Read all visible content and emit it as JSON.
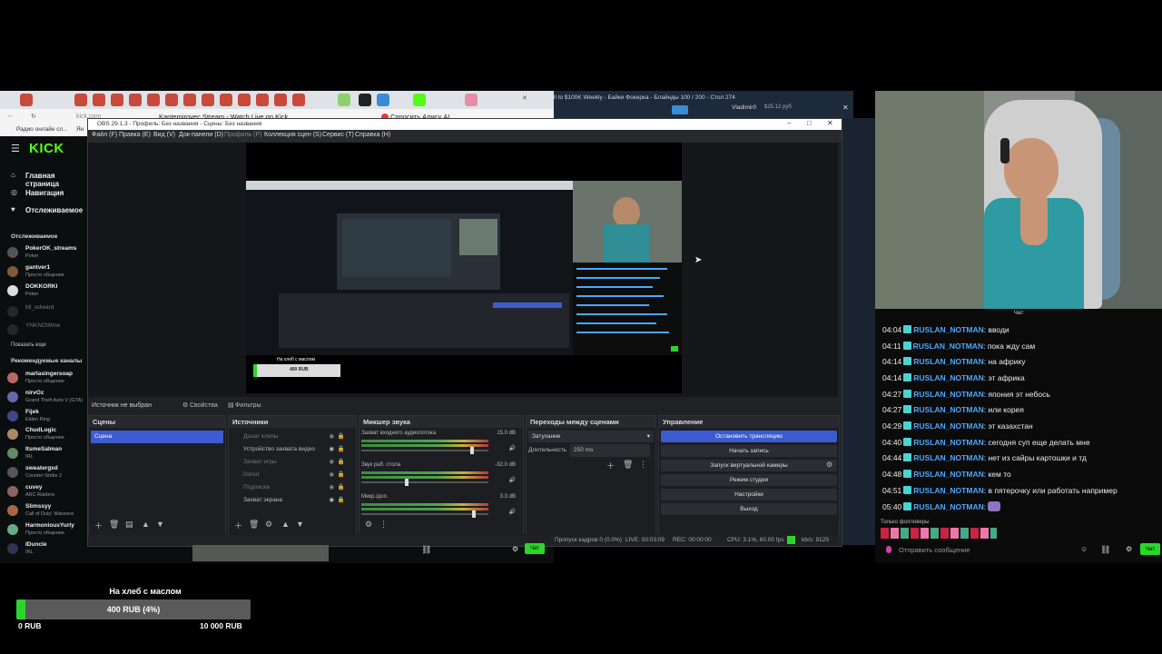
{
  "browser": {
    "page_tab_title": "Kantemirovec Stream - Watch Live on Kick",
    "address": "kick.com",
    "search_button": "Спросить Алису AI",
    "bookmark": "Радио онлайн сл...",
    "bookmark2": "Ян",
    "second_window_title": "ll to $100K Weekly - Байки Фокерка - Блайнды 100 / 200 - Стол 274",
    "second_window_user": "Vladimir0",
    "second_window_balance": "$25.12 руб"
  },
  "kick": {
    "logo": "KICK",
    "nav": [
      "Главная страница",
      "Навигация",
      "Отслеживаемое"
    ],
    "followed_header": "Отслеживаемое",
    "followed": [
      {
        "name": "PokerOK_streams",
        "game": "Poker"
      },
      {
        "name": "gantver1",
        "game": "Просто общение"
      },
      {
        "name": "DOKKORKI",
        "game": "Poker"
      },
      {
        "name": "bil_edward",
        "game": ""
      },
      {
        "name": "YNKNOWme",
        "game": ""
      }
    ],
    "show_more": "Показать еще",
    "recommended_header": "Рекомендуемые каналы",
    "recommended": [
      {
        "name": "marlasingersoap",
        "game": "Просто общение"
      },
      {
        "name": "nirvOz",
        "game": "Grand Theft Auto V (GTA)"
      },
      {
        "name": "Fijek",
        "game": "Elden Ring"
      },
      {
        "name": "ChudLogic",
        "game": "Просто общение"
      },
      {
        "name": "ItsmeSalman",
        "game": "IRL"
      },
      {
        "name": "sweatergxd",
        "game": "Counter-Strike 2"
      },
      {
        "name": "cuvey",
        "game": "ARC Raiders"
      },
      {
        "name": "Slimssyy",
        "game": "Call of Duty: Warzone"
      },
      {
        "name": "HarmoniousYurly",
        "game": "Просто общение"
      },
      {
        "name": "IDuncle",
        "game": "IRL"
      }
    ]
  },
  "obs": {
    "window_title": "OBS 29.1.3 - Профиль: Без названия - Сцены: Без названия",
    "menu": [
      "Файл (F)",
      "Правка (E)",
      "Вид (V)",
      "Док-панели (D)",
      "Профиль (P)",
      "Коллекция сцен (S)",
      "Сервис (T)",
      "Справка (H)"
    ],
    "source_selected": "Источник не выбран",
    "properties_button": "Свойства",
    "filters_button": "Фильтры",
    "scenes": {
      "title": "Сцены",
      "items": [
        "Сцена"
      ]
    },
    "sources": {
      "title": "Источники",
      "items": [
        "Донат клипы",
        "Устройство захвата видео",
        "Захват игры",
        "Donut",
        "Подписка",
        "Захват экрана"
      ]
    },
    "mixer": {
      "title": "Микшер звука",
      "channels": [
        {
          "name": "Захват входного аудиопотока",
          "db": "15.0 dB",
          "level": 0.88
        },
        {
          "name": "Звук раб. стола",
          "db": "-32.0 dB",
          "level": 0.35
        },
        {
          "name": "Микр./доп.",
          "db": "3.3 dB",
          "level": 0.9
        }
      ]
    },
    "transitions": {
      "title": "Переходы между сценами",
      "selected": "Затухание",
      "duration_label": "Длительность",
      "duration": "250 ms"
    },
    "controls": {
      "title": "Управление",
      "buttons": [
        "Остановить трансляцию",
        "Начать запись",
        "Запуск виртуальной камеры",
        "Режим студии",
        "Настройки",
        "Выход"
      ]
    },
    "status": {
      "dropped": "Пропуск кадров 0 (0.0%)",
      "live": "LIVE: 00:03:09",
      "rec": "REC: 00:00:00",
      "cpu": "CPU: 3.1%, 60.00 fps",
      "kbps": "kb/s: 9125"
    },
    "preview_overlay": {
      "donation_title": "На хлеб с маслом",
      "donation_value": "400 RUB"
    }
  },
  "chat": {
    "header": "Чат",
    "messages": [
      {
        "time": "04:04",
        "user": "RUSLAN_NOTMAN",
        "text": "вводи"
      },
      {
        "time": "04:11",
        "user": "RUSLAN_NOTMAN",
        "text": "пока жду сам"
      },
      {
        "time": "04:14",
        "user": "RUSLAN_NOTMAN",
        "text": "на африку"
      },
      {
        "time": "04:14",
        "user": "RUSLAN_NOTMAN",
        "text": "эт африка"
      },
      {
        "time": "04:27",
        "user": "RUSLAN_NOTMAN",
        "text": "япония эт небось"
      },
      {
        "time": "04:27",
        "user": "RUSLAN_NOTMAN",
        "text": "или корея"
      },
      {
        "time": "04:29",
        "user": "RUSLAN_NOTMAN",
        "text": "эт казахстан"
      },
      {
        "time": "04:40",
        "user": "RUSLAN_NOTMAN",
        "text": "сегодня суп еще делать мне"
      },
      {
        "time": "04:44",
        "user": "RUSLAN_NOTMAN",
        "text": "нет из сайры картошки и тд"
      },
      {
        "time": "04:48",
        "user": "RUSLAN_NOTMAN",
        "text": "кем то"
      },
      {
        "time": "04:51",
        "user": "RUSLAN_NOTMAN",
        "text": "в пятерочку или работать например"
      },
      {
        "time": "05:40",
        "user": "RUSLAN_NOTMAN",
        "text": ""
      }
    ],
    "followers_label": "Только фолловеры",
    "input_placeholder": "Отправить сообщение",
    "send_button": "Чат"
  },
  "donation": {
    "title": "На хлеб с маслом",
    "progress_text": "400 RUB (4%)",
    "progress_fraction": 0.04,
    "min_label": "0 RUB",
    "max_label": "10 000 RUB"
  },
  "colors": {
    "kick_green": "#53fc18",
    "obs_blue": "#3c5bd0",
    "chat_user": "#4aa8ff",
    "donation_green": "#2bd62b"
  }
}
